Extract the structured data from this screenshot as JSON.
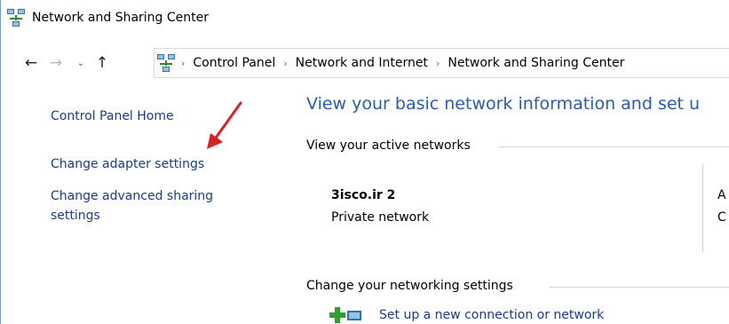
{
  "window": {
    "title": "Network and Sharing Center"
  },
  "nav": {
    "back_icon": "←",
    "forward_icon": "→",
    "history_icon": "⌄",
    "up_icon": "↑",
    "breadcrumb": [
      "Control Panel",
      "Network and Internet",
      "Network and Sharing Center"
    ],
    "separator": "›"
  },
  "sidebar": {
    "items": [
      {
        "label": "Control Panel Home"
      },
      {
        "label": "Change adapter settings"
      },
      {
        "label": "Change advanced sharing settings"
      }
    ]
  },
  "main": {
    "heading": "View your basic network information and set u",
    "active_networks_label": "View your active networks",
    "network": {
      "name": "3isco.ir  2",
      "type": "Private network",
      "col2_line1": "A",
      "col2_line2": "C"
    },
    "change_settings_label": "Change your networking settings",
    "tasks": [
      {
        "label": "Set up a new connection or network"
      }
    ]
  },
  "colors": {
    "link": "#1a3b91",
    "heading": "#2a5bb5",
    "annotation_arrow": "#e02020"
  }
}
